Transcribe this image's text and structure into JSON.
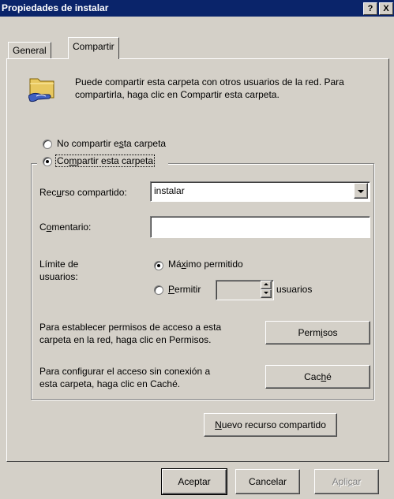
{
  "title": "Propiedades de instalar",
  "title_buttons": {
    "help": "?",
    "close": "X"
  },
  "tabs": [
    {
      "label": "General"
    },
    {
      "label": "Compartir"
    }
  ],
  "intro": {
    "line1": "Puede compartir esta carpeta con otros usuarios de la red. Para",
    "line2": "compartirla, haga clic en Compartir esta carpeta."
  },
  "no_share": {
    "pre": "No compartir e",
    "u": "s",
    "post": "ta carpeta"
  },
  "share": {
    "pre": "Co",
    "u": "m",
    "post": "partir esta carpeta"
  },
  "resource": {
    "pre": "Rec",
    "u": "u",
    "post": "rso compartido:",
    "value": "instalar"
  },
  "comment": {
    "pre": "C",
    "u": "o",
    "post": "mentario:",
    "value": ""
  },
  "limit": {
    "label_line1": "Límite de",
    "label_line2": "usuarios:",
    "max": {
      "pre": "Má",
      "u": "x",
      "post": "imo permitido"
    },
    "allow": {
      "pre": "",
      "u": "P",
      "post": "ermitir"
    },
    "allow_value": "",
    "users_label": "usuarios"
  },
  "permissions": {
    "line1": "Para establecer permisos de acceso a esta",
    "line2": "carpeta en la red, haga clic en Permisos.",
    "btn_pre": "Perm",
    "btn_u": "i",
    "btn_post": "sos"
  },
  "cache": {
    "line1": "Para configurar el acceso sin conexión a",
    "line2": "esta carpeta, haga clic en Caché.",
    "btn_pre": "Cac",
    "btn_u": "h",
    "btn_post": "é"
  },
  "new_share": {
    "pre": "",
    "u": "N",
    "post": "uevo recurso compartido"
  },
  "footer": {
    "ok": "Aceptar",
    "cancel": "Cancelar",
    "apply_pre": "Apli",
    "apply_u": "c",
    "apply_post": "ar"
  }
}
